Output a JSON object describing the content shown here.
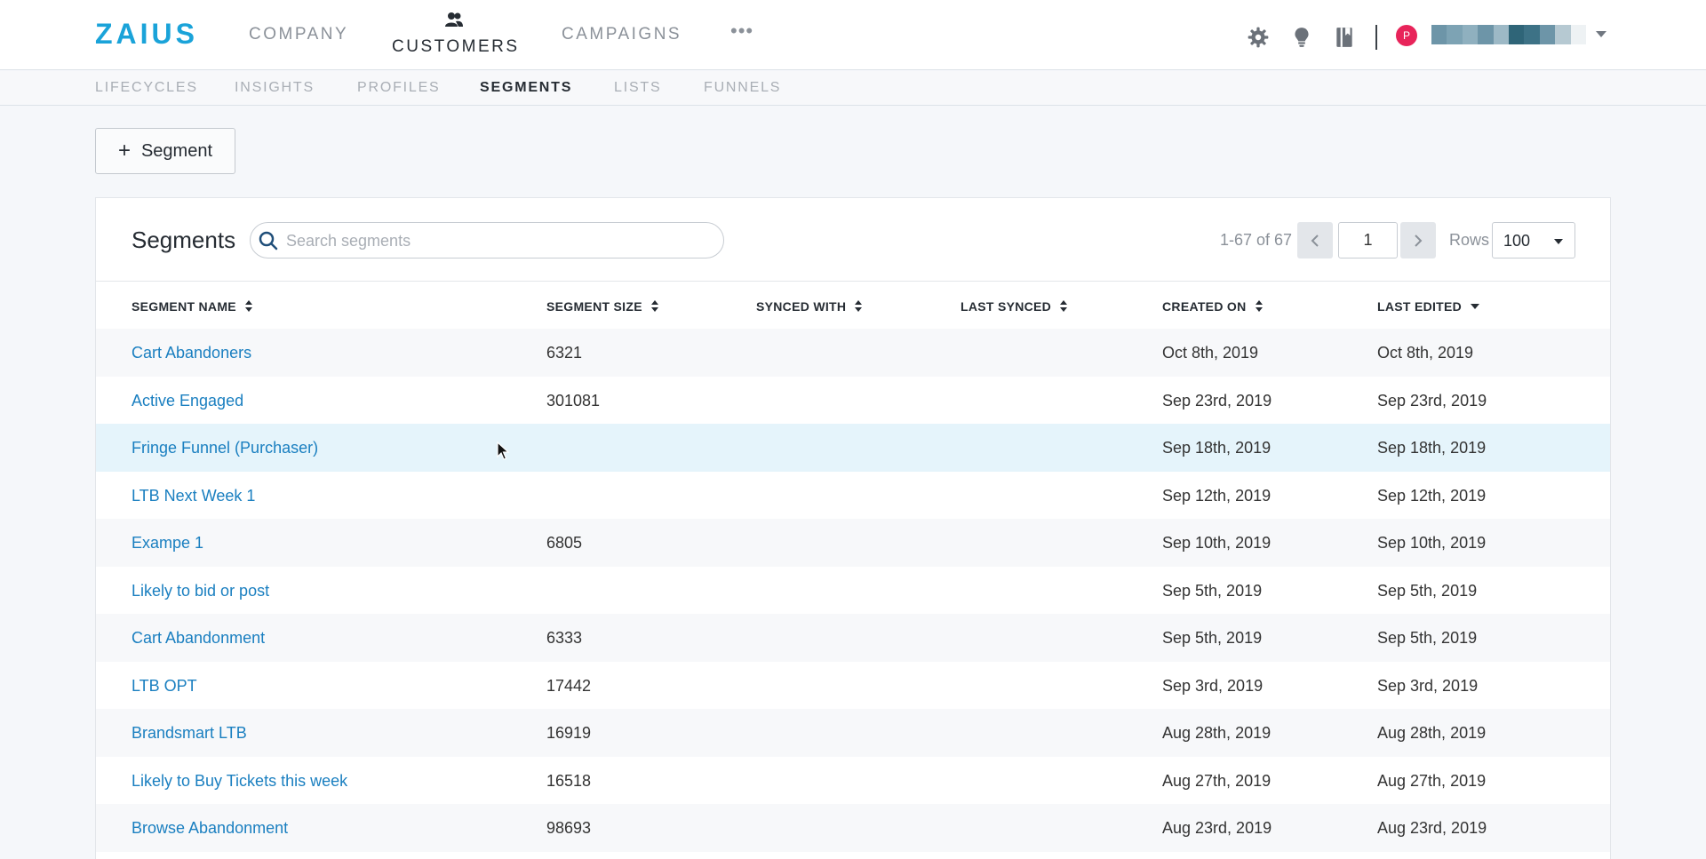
{
  "header": {
    "logo": "ZAIUS",
    "nav": [
      {
        "label": "COMPANY"
      },
      {
        "label": "CUSTOMERS"
      },
      {
        "label": "CAMPAIGNS"
      }
    ],
    "more": "•••",
    "user_avatar_letter": "P"
  },
  "subnav": [
    {
      "label": "LIFECYCLES"
    },
    {
      "label": "INSIGHTS"
    },
    {
      "label": "PROFILES"
    },
    {
      "label": "SEGMENTS"
    },
    {
      "label": "LISTS"
    },
    {
      "label": "FUNNELS"
    }
  ],
  "add_button": {
    "icon": "+",
    "label": "Segment"
  },
  "panel": {
    "title": "Segments",
    "search_placeholder": "Search segments",
    "pager_text": "1-67 of 67",
    "page_value": "1",
    "rows_label": "Rows",
    "rows_value": "100"
  },
  "table": {
    "columns": [
      "SEGMENT NAME",
      "SEGMENT SIZE",
      "SYNCED WITH",
      "LAST SYNCED",
      "CREATED ON",
      "LAST EDITED"
    ],
    "rows": [
      {
        "name": "Cart Abandoners",
        "size": "6321",
        "synced_with": "",
        "last_synced": "",
        "created": "Oct 8th, 2019",
        "edited": "Oct 8th, 2019"
      },
      {
        "name": "Active Engaged",
        "size": "301081",
        "synced_with": "",
        "last_synced": "",
        "created": "Sep 23rd, 2019",
        "edited": "Sep 23rd, 2019"
      },
      {
        "name": "Fringe Funnel (Purchaser)",
        "size": "",
        "synced_with": "",
        "last_synced": "",
        "created": "Sep 18th, 2019",
        "edited": "Sep 18th, 2019"
      },
      {
        "name": "LTB Next Week 1",
        "size": "",
        "synced_with": "",
        "last_synced": "",
        "created": "Sep 12th, 2019",
        "edited": "Sep 12th, 2019"
      },
      {
        "name": "Exampe 1",
        "size": "6805",
        "synced_with": "",
        "last_synced": "",
        "created": "Sep 10th, 2019",
        "edited": "Sep 10th, 2019"
      },
      {
        "name": "Likely to bid or post",
        "size": "",
        "synced_with": "",
        "last_synced": "",
        "created": "Sep 5th, 2019",
        "edited": "Sep 5th, 2019"
      },
      {
        "name": "Cart Abandonment",
        "size": "6333",
        "synced_with": "",
        "last_synced": "",
        "created": "Sep 5th, 2019",
        "edited": "Sep 5th, 2019"
      },
      {
        "name": "LTB OPT",
        "size": "17442",
        "synced_with": "",
        "last_synced": "",
        "created": "Sep 3rd, 2019",
        "edited": "Sep 3rd, 2019"
      },
      {
        "name": "Brandsmart LTB",
        "size": "16919",
        "synced_with": "",
        "last_synced": "",
        "created": "Aug 28th, 2019",
        "edited": "Aug 28th, 2019"
      },
      {
        "name": "Likely to Buy Tickets this week",
        "size": "16518",
        "synced_with": "",
        "last_synced": "",
        "created": "Aug 27th, 2019",
        "edited": "Aug 27th, 2019"
      },
      {
        "name": "Browse Abandonment",
        "size": "98693",
        "synced_with": "",
        "last_synced": "",
        "created": "Aug 23rd, 2019",
        "edited": "Aug 23rd, 2019"
      }
    ]
  },
  "colors": {
    "accent": "#1aa3d9",
    "link": "#1a7fc0",
    "hover_row": "#e5f4fb",
    "avatar": "#e8245a"
  }
}
